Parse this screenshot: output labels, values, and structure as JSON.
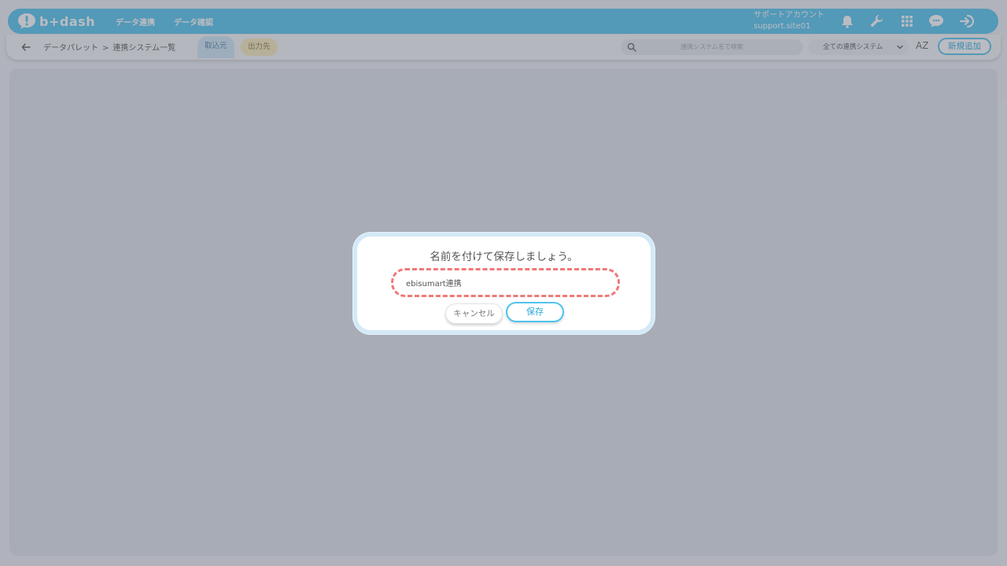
{
  "header": {
    "logo_text": "b+dash",
    "nav": [
      {
        "label": "データ連携"
      },
      {
        "label": "データ確認"
      }
    ],
    "account_name": "サポートアカウント",
    "account_id": "support.site01",
    "icons": [
      "bell-icon",
      "wrench-icon",
      "grid-icon",
      "chat-icon",
      "logout-icon"
    ]
  },
  "subheader": {
    "breadcrumb_root": "データパレット",
    "breadcrumb_separator": ">",
    "breadcrumb_current": "連携システム一覧",
    "tab_import": "取込元",
    "tab_export": "出力先",
    "search_placeholder": "連携システム名で検索",
    "filter_selected": "全ての連携システム",
    "sort_label": "AZ",
    "new_button": "新規追加"
  },
  "modal": {
    "title": "名前を付けて保存しましょう。",
    "input_value": "ebisumart連携",
    "cancel_label": "キャンセル",
    "save_label": "保存"
  },
  "colors": {
    "brand": "#4fc3ee",
    "input_highlight": "#f07878",
    "tab_import_bg": "#cfe6f4",
    "tab_export_bg": "#f8eab8"
  }
}
